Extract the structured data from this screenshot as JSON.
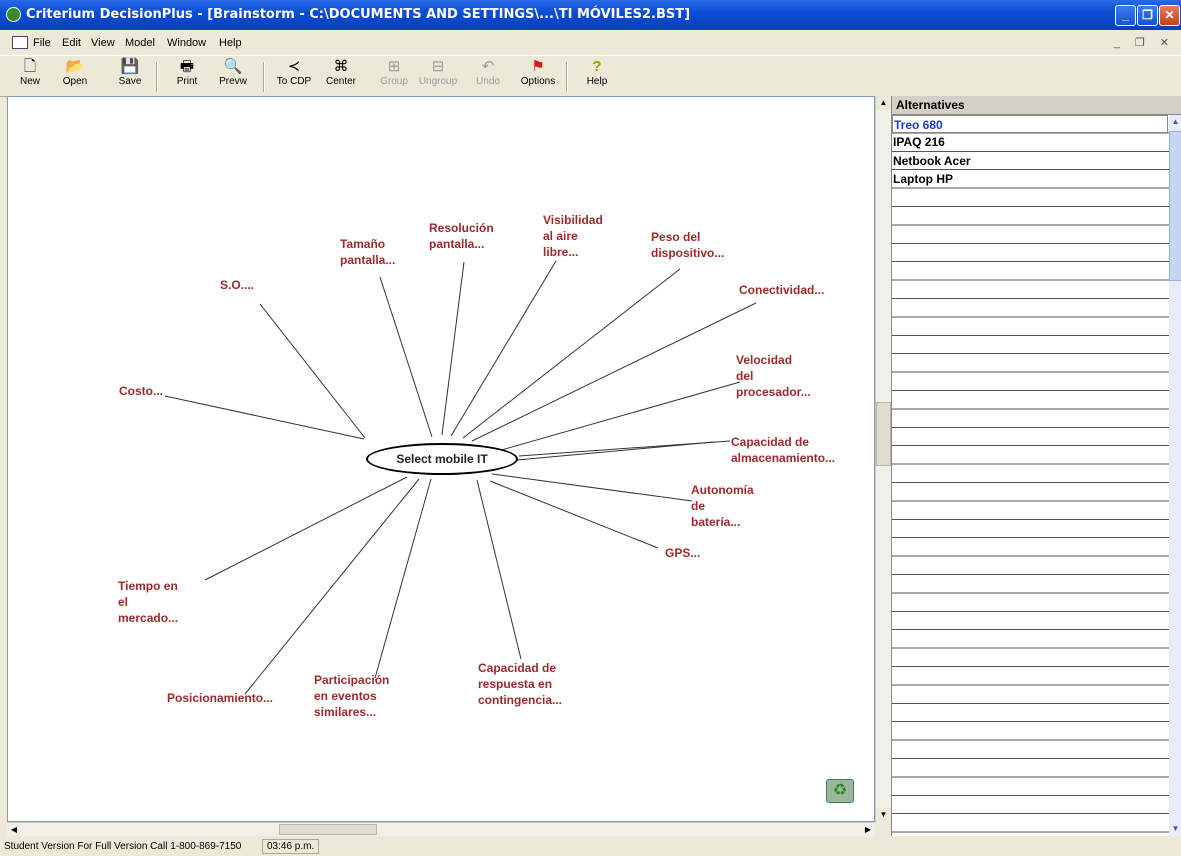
{
  "window": {
    "title": "Criterium DecisionPlus - [Brainstorm - C:\\DOCUMENTS AND SETTINGS\\...\\TI MÓVILES2.BST]"
  },
  "menu": [
    "File",
    "Edit",
    "View",
    "Model",
    "Window",
    "Help"
  ],
  "toolbar": [
    {
      "label": "New",
      "icon": "new-document-icon",
      "glyph": "🗋",
      "enabled": true
    },
    {
      "label": "Open",
      "icon": "open-folder-icon",
      "glyph": "📂",
      "enabled": true
    },
    {
      "label": "Save",
      "icon": "floppy-disk-icon",
      "glyph": "💾",
      "enabled": true
    },
    {
      "label": "Print",
      "icon": "printer-icon",
      "glyph": "🖶",
      "enabled": true
    },
    {
      "label": "Prevw",
      "icon": "print-preview-icon",
      "glyph": "🔍",
      "enabled": true
    },
    {
      "label": "To CDP",
      "icon": "to-cdp-icon",
      "glyph": "≺",
      "enabled": true
    },
    {
      "label": "Center",
      "icon": "center-icon",
      "glyph": "⌘",
      "enabled": true
    },
    {
      "label": "Group",
      "icon": "group-icon",
      "glyph": "⊞",
      "enabled": false
    },
    {
      "label": "Ungroup",
      "icon": "ungroup-icon",
      "glyph": "⊟",
      "enabled": false
    },
    {
      "label": "Undo",
      "icon": "undo-icon",
      "glyph": "↶",
      "enabled": false
    },
    {
      "label": "Options",
      "icon": "options-icon",
      "glyph": "⚑",
      "enabled": true
    },
    {
      "label": "Help",
      "icon": "help-icon",
      "glyph": "?",
      "enabled": true
    }
  ],
  "brainstorm": {
    "center": "Select mobile IT",
    "nodes": [
      {
        "id": "so",
        "lines": [
          "S.O...."
        ]
      },
      {
        "id": "tamano",
        "lines": [
          "Tamaño",
          "pantalla..."
        ]
      },
      {
        "id": "resolucion",
        "lines": [
          "Resolución",
          "pantalla..."
        ]
      },
      {
        "id": "visibilidad",
        "lines": [
          "Visibilidad",
          "al aire",
          "libre..."
        ]
      },
      {
        "id": "peso",
        "lines": [
          "Peso del",
          "dispositivo..."
        ]
      },
      {
        "id": "conectividad",
        "lines": [
          "Conectividad..."
        ]
      },
      {
        "id": "velocidad",
        "lines": [
          "Velocidad",
          "del",
          "procesador..."
        ]
      },
      {
        "id": "almacenamiento",
        "lines": [
          "Capacidad de",
          "almacenamiento..."
        ]
      },
      {
        "id": "autonomia",
        "lines": [
          "Autonomía",
          "de",
          "batería..."
        ]
      },
      {
        "id": "gps",
        "lines": [
          "GPS..."
        ]
      },
      {
        "id": "respuesta",
        "lines": [
          "Capacidad de",
          "respuesta en",
          "contingencia..."
        ]
      },
      {
        "id": "participacion",
        "lines": [
          "Participación",
          "en eventos",
          "similares..."
        ]
      },
      {
        "id": "posicionamiento",
        "lines": [
          "Posicionamiento..."
        ]
      },
      {
        "id": "tiempo",
        "lines": [
          "Tiempo en",
          "el",
          "mercado..."
        ]
      },
      {
        "id": "costo",
        "lines": [
          "Costo..."
        ]
      }
    ]
  },
  "alternatives": {
    "header": "Alternatives",
    "items": [
      "Treo 680",
      "IPAQ 216",
      "Netbook Acer",
      "Laptop HP"
    ]
  },
  "status": {
    "message": "Student Version For Full Version Call 1-800-869-7150",
    "time": "03:46 p.m."
  }
}
